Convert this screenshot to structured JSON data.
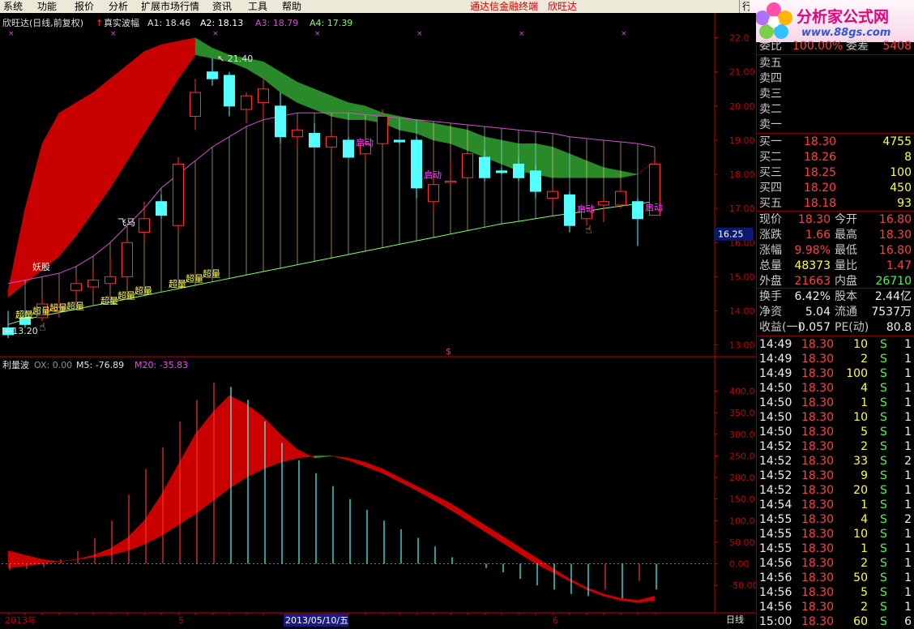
{
  "menu": {
    "items": [
      "系统",
      "功能",
      "报价",
      "分析",
      "扩展市场行情",
      "资讯",
      "工具",
      "帮助"
    ],
    "broker_title": "通达信金融终端",
    "stock_name": "欣旺达",
    "right_tab": "行"
  },
  "logo": {
    "title": "分析家公式网",
    "url": "www.88gs.com"
  },
  "main_header": {
    "title": "欣旺达(日线,前复权)",
    "indicator": "真实波幅",
    "a1": "A1: 18.46",
    "a2": "A2: 18.13",
    "a3": "A3: 18.79",
    "a4": "A4: 17.39"
  },
  "sub_header": {
    "title": "利量波",
    "ox": "OX: 0.00",
    "m5": "M5: -76.89",
    "m20": "M20: -35.83"
  },
  "bottom_axis": {
    "labels": [
      "2013年",
      "5",
      "2013/05/10/五",
      "6"
    ],
    "period_button": "日线"
  },
  "colors": {
    "up": "#ff3030",
    "down": "#54ffff",
    "band_up": "#c80000",
    "band_down": "#2a8a2a",
    "purple_line": "#d050d0",
    "green_line": "#80ff60",
    "yellow_text": "#ffff60",
    "magenta_text": "#ff40ff",
    "axis_red": "#c00000"
  },
  "chart_data": [
    {
      "type": "candlestick",
      "title": "欣旺达(日线,前复权)",
      "ylim": [
        12.8,
        22.3
      ],
      "y_ticks": [
        "22.0",
        "21.00",
        "20.00",
        "19.00",
        "18.00",
        "17.00",
        "16.00",
        "15.00",
        "14.00",
        "13.00"
      ],
      "current_price_label": "16.25",
      "high_marker": "21.40",
      "low_marker": "13.20",
      "candles": [
        {
          "o": 13.5,
          "h": 14.0,
          "l": 13.2,
          "c": 13.3
        },
        {
          "o": 13.8,
          "h": 14.0,
          "l": 13.5,
          "c": 13.6
        },
        {
          "o": 13.8,
          "h": 14.4,
          "l": 13.7,
          "c": 14.2
        },
        {
          "o": 14.0,
          "h": 14.4,
          "l": 13.8,
          "c": 14.1
        },
        {
          "o": 14.6,
          "h": 15.0,
          "l": 14.3,
          "c": 14.8
        },
        {
          "o": 14.7,
          "h": 15.2,
          "l": 14.5,
          "c": 14.9
        },
        {
          "o": 14.8,
          "h": 15.6,
          "l": 14.7,
          "c": 15.0
        },
        {
          "o": 15.0,
          "h": 16.1,
          "l": 14.8,
          "c": 16.0
        },
        {
          "o": 16.3,
          "h": 17.2,
          "l": 16.0,
          "c": 16.7
        },
        {
          "o": 17.2,
          "h": 17.4,
          "l": 16.7,
          "c": 16.8
        },
        {
          "o": 16.5,
          "h": 18.5,
          "l": 16.3,
          "c": 18.3
        },
        {
          "o": 19.7,
          "h": 20.8,
          "l": 19.3,
          "c": 20.4
        },
        {
          "o": 21.0,
          "h": 21.4,
          "l": 20.6,
          "c": 20.8
        },
        {
          "o": 20.9,
          "h": 21.0,
          "l": 19.7,
          "c": 20.0
        },
        {
          "o": 19.9,
          "h": 20.4,
          "l": 19.5,
          "c": 20.3
        },
        {
          "o": 20.1,
          "h": 20.8,
          "l": 19.6,
          "c": 20.5
        },
        {
          "o": 20.0,
          "h": 20.4,
          "l": 18.9,
          "c": 19.1
        },
        {
          "o": 19.1,
          "h": 19.5,
          "l": 18.8,
          "c": 19.3
        },
        {
          "o": 19.2,
          "h": 19.5,
          "l": 18.8,
          "c": 18.8
        },
        {
          "o": 18.8,
          "h": 19.2,
          "l": 18.7,
          "c": 19.1
        },
        {
          "o": 19.0,
          "h": 19.1,
          "l": 18.5,
          "c": 18.5
        },
        {
          "o": 18.6,
          "h": 19.0,
          "l": 18.4,
          "c": 18.9
        },
        {
          "o": 18.9,
          "h": 19.9,
          "l": 18.9,
          "c": 19.7
        },
        {
          "o": 19.0,
          "h": 19.0,
          "l": 18.9,
          "c": 18.95
        },
        {
          "o": 19.0,
          "h": 19.1,
          "l": 17.3,
          "c": 17.6
        },
        {
          "o": 17.2,
          "h": 17.9,
          "l": 16.9,
          "c": 17.7
        },
        {
          "o": 17.8,
          "h": 18.4,
          "l": 17.7,
          "c": 17.8
        },
        {
          "o": 17.9,
          "h": 18.6,
          "l": 17.9,
          "c": 18.6
        },
        {
          "o": 18.5,
          "h": 18.7,
          "l": 17.8,
          "c": 17.9
        },
        {
          "o": 18.1,
          "h": 18.2,
          "l": 18.0,
          "c": 18.05
        },
        {
          "o": 18.3,
          "h": 18.5,
          "l": 17.8,
          "c": 17.9
        },
        {
          "o": 18.1,
          "h": 18.3,
          "l": 17.3,
          "c": 17.5
        },
        {
          "o": 17.3,
          "h": 17.6,
          "l": 17.0,
          "c": 17.5
        },
        {
          "o": 17.4,
          "h": 17.5,
          "l": 16.3,
          "c": 16.5
        },
        {
          "o": 16.7,
          "h": 17.0,
          "l": 16.5,
          "c": 17.0
        },
        {
          "o": 17.1,
          "h": 17.3,
          "l": 16.6,
          "c": 17.2
        },
        {
          "o": 17.1,
          "h": 17.6,
          "l": 17.0,
          "c": 17.5
        },
        {
          "o": 17.2,
          "h": 17.3,
          "l": 15.9,
          "c": 16.7
        },
        {
          "o": 16.8,
          "h": 18.5,
          "l": 16.8,
          "c": 18.3
        }
      ],
      "band_top": [
        14.6,
        17.0,
        18.9,
        19.8,
        20.1,
        20.4,
        20.8,
        21.2,
        21.6,
        21.8,
        21.9,
        22.0,
        21.7,
        21.5,
        21.4,
        21.3,
        21.0,
        20.7,
        20.5,
        20.3,
        20.1,
        20.0,
        19.8,
        19.7,
        19.6,
        19.5,
        19.4,
        19.3,
        19.1,
        19.0,
        18.9,
        18.9,
        18.8,
        18.6,
        18.4,
        18.2,
        18.1,
        18.0,
        18.4
      ],
      "band_bottom": [
        14.4,
        14.8,
        15.2,
        15.6,
        16.2,
        16.9,
        17.6,
        18.4,
        19.2,
        20.0,
        20.8,
        21.5,
        21.4,
        21.3,
        21.1,
        20.8,
        20.4,
        20.1,
        19.9,
        19.7,
        19.6,
        19.6,
        19.5,
        19.3,
        19.2,
        19.0,
        18.9,
        18.7,
        18.5,
        18.3,
        18.1,
        18.0,
        17.9,
        17.9,
        17.9,
        17.9,
        17.9,
        18.0,
        18.4
      ],
      "purple_line": [
        14.8,
        14.9,
        15.0,
        15.1,
        15.3,
        15.6,
        16.0,
        16.5,
        17.0,
        17.6,
        18.0,
        18.4,
        18.8,
        19.1,
        19.4,
        19.6,
        19.7,
        19.8,
        19.8,
        19.8,
        19.8,
        19.75,
        19.7,
        19.65,
        19.6,
        19.55,
        19.5,
        19.45,
        19.4,
        19.35,
        19.3,
        19.25,
        19.2,
        19.1,
        19.05,
        19.0,
        18.95,
        18.9,
        18.8
      ],
      "green_line": [
        13.6,
        13.75,
        13.85,
        13.95,
        14.05,
        14.15,
        14.25,
        14.35,
        14.45,
        14.55,
        14.65,
        14.75,
        14.85,
        14.95,
        15.05,
        15.15,
        15.25,
        15.35,
        15.45,
        15.55,
        15.65,
        15.75,
        15.85,
        15.95,
        16.05,
        16.15,
        16.25,
        16.35,
        16.45,
        16.55,
        16.62,
        16.7,
        16.78,
        16.85,
        16.92,
        17.0,
        17.07,
        17.14,
        17.2
      ],
      "annotations": [
        {
          "text": "超量",
          "i": 1,
          "y": 13.8,
          "kind": "yellow"
        },
        {
          "text": "超量",
          "i": 2,
          "y": 13.9,
          "kind": "yellow"
        },
        {
          "text": "超量",
          "i": 3,
          "y": 14.0,
          "kind": "yellow"
        },
        {
          "text": "超量",
          "i": 4,
          "y": 14.05,
          "kind": "yellow"
        },
        {
          "text": "超量",
          "i": 6,
          "y": 14.2,
          "kind": "yellow"
        },
        {
          "text": "超量",
          "i": 7,
          "y": 14.35,
          "kind": "yellow"
        },
        {
          "text": "超量",
          "i": 8,
          "y": 14.5,
          "kind": "yellow"
        },
        {
          "text": "超量",
          "i": 10,
          "y": 14.7,
          "kind": "yellow"
        },
        {
          "text": "超量",
          "i": 11,
          "y": 14.85,
          "kind": "yellow"
        },
        {
          "text": "超量",
          "i": 12,
          "y": 15.0,
          "kind": "yellow"
        },
        {
          "text": "妖股",
          "i": 2,
          "y": 15.2,
          "kind": "white"
        },
        {
          "text": "飞马",
          "i": 7,
          "y": 16.5,
          "kind": "white"
        },
        {
          "text": "启动",
          "i": 21,
          "y": 18.85,
          "kind": "magenta"
        },
        {
          "text": "启动",
          "i": 25,
          "y": 17.9,
          "kind": "magenta"
        },
        {
          "text": "启动",
          "i": 34,
          "y": 16.9,
          "kind": "magenta"
        },
        {
          "text": "启动",
          "i": 38,
          "y": 16.95,
          "kind": "magenta"
        }
      ]
    },
    {
      "type": "area",
      "title": "利量波",
      "ylim": [
        -110,
        450
      ],
      "y_ticks": [
        "400.0",
        "350.0",
        "300.0",
        "250.0",
        "200.0",
        "150.0",
        "100.0",
        "50.00",
        "0.00",
        "-50.00"
      ],
      "x_labels": [
        "2013年",
        "5",
        "2013/05/10/五",
        "6"
      ],
      "band_a": [
        30,
        20,
        10,
        5,
        10,
        20,
        35,
        60,
        100,
        160,
        230,
        300,
        350,
        390,
        370,
        340,
        300,
        265,
        245,
        250,
        245,
        235,
        220,
        200,
        180,
        160,
        140,
        115,
        90,
        65,
        40,
        15,
        -10,
        -35,
        -55,
        -70,
        -80,
        -85,
        -75
      ],
      "band_b": [
        -10,
        -5,
        0,
        5,
        10,
        15,
        20,
        30,
        45,
        65,
        90,
        115,
        145,
        175,
        200,
        220,
        235,
        245,
        250,
        250,
        240,
        225,
        210,
        190,
        170,
        148,
        125,
        100,
        75,
        50,
        25,
        0,
        -20,
        -40,
        -60,
        -75,
        -85,
        -90,
        -85
      ],
      "bars": [
        -15,
        -12,
        -8,
        10,
        30,
        60,
        100,
        160,
        220,
        270,
        330,
        380,
        420,
        410,
        380,
        330,
        280,
        240,
        210,
        180,
        150,
        125,
        100,
        80,
        60,
        40,
        15,
        0,
        -10,
        -20,
        -35,
        -50,
        -60,
        -70,
        -75,
        -60,
        -80,
        -40,
        -60
      ]
    }
  ],
  "quote_panel": {
    "ratio_row": {
      "label": "委比",
      "value": "100.00%",
      "label2": "委差",
      "value2": "5408"
    },
    "sell_levels": [
      "卖五",
      "卖四",
      "卖三",
      "卖二",
      "卖一"
    ],
    "buy_levels": [
      {
        "label": "买一",
        "price": "18.30",
        "vol": "4755"
      },
      {
        "label": "买二",
        "price": "18.26",
        "vol": "8"
      },
      {
        "label": "买三",
        "price": "18.25",
        "vol": "100"
      },
      {
        "label": "买四",
        "price": "18.20",
        "vol": "450"
      },
      {
        "label": "买五",
        "price": "18.18",
        "vol": "93"
      }
    ],
    "stats": [
      {
        "l1": "现价",
        "v1": "18.30",
        "l2": "今开",
        "v2": "16.80",
        "c1": "red",
        "c2": "red"
      },
      {
        "l1": "涨跌",
        "v1": "1.66",
        "l2": "最高",
        "v2": "18.30",
        "c1": "red",
        "c2": "red"
      },
      {
        "l1": "涨幅",
        "v1": "9.98%",
        "l2": "最低",
        "v2": "16.80",
        "c1": "red",
        "c2": "red"
      },
      {
        "l1": "总量",
        "v1": "48373",
        "l2": "量比",
        "v2": "1.47",
        "c1": "yel",
        "c2": "red"
      },
      {
        "l1": "外盘",
        "v1": "21663",
        "l2": "内盘",
        "v2": "26710",
        "c1": "red",
        "c2": "grn"
      }
    ],
    "stats2": [
      {
        "l1": "换手",
        "v1": "6.42%",
        "l2": "股本",
        "v2": "2.44亿"
      },
      {
        "l1": "净资",
        "v1": "5.04",
        "l2": "流通",
        "v2": "7537万"
      },
      {
        "l1": "收益(一)",
        "v1": "0.057",
        "l2": "PE(动)",
        "v2": "80.8"
      }
    ],
    "ticks": [
      {
        "t": "14:49",
        "p": "18.30",
        "v": "10",
        "s": "S",
        "n": "1"
      },
      {
        "t": "14:49",
        "p": "18.30",
        "v": "2",
        "s": "S",
        "n": "1"
      },
      {
        "t": "14:49",
        "p": "18.30",
        "v": "100",
        "s": "S",
        "n": "1"
      },
      {
        "t": "14:50",
        "p": "18.30",
        "v": "4",
        "s": "S",
        "n": "1"
      },
      {
        "t": "14:50",
        "p": "18.30",
        "v": "1",
        "s": "S",
        "n": "1"
      },
      {
        "t": "14:50",
        "p": "18.30",
        "v": "10",
        "s": "S",
        "n": "1"
      },
      {
        "t": "14:50",
        "p": "18.30",
        "v": "5",
        "s": "S",
        "n": "1"
      },
      {
        "t": "14:52",
        "p": "18.30",
        "v": "2",
        "s": "S",
        "n": "1"
      },
      {
        "t": "14:52",
        "p": "18.30",
        "v": "33",
        "s": "S",
        "n": "2"
      },
      {
        "t": "14:52",
        "p": "18.30",
        "v": "9",
        "s": "S",
        "n": "1"
      },
      {
        "t": "14:52",
        "p": "18.30",
        "v": "20",
        "s": "S",
        "n": "1"
      },
      {
        "t": "14:54",
        "p": "18.30",
        "v": "1",
        "s": "S",
        "n": "1"
      },
      {
        "t": "14:55",
        "p": "18.30",
        "v": "4",
        "s": "S",
        "n": "2"
      },
      {
        "t": "14:55",
        "p": "18.30",
        "v": "10",
        "s": "S",
        "n": "1"
      },
      {
        "t": "14:55",
        "p": "18.30",
        "v": "1",
        "s": "S",
        "n": "1"
      },
      {
        "t": "14:56",
        "p": "18.30",
        "v": "2",
        "s": "S",
        "n": "1"
      },
      {
        "t": "14:56",
        "p": "18.30",
        "v": "50",
        "s": "S",
        "n": "1"
      },
      {
        "t": "14:56",
        "p": "18.30",
        "v": "5",
        "s": "S",
        "n": "1"
      },
      {
        "t": "14:56",
        "p": "18.30",
        "v": "2",
        "s": "S",
        "n": "1"
      },
      {
        "t": "15:00",
        "p": "18.30",
        "v": "60",
        "s": "S",
        "n": "6"
      }
    ]
  }
}
